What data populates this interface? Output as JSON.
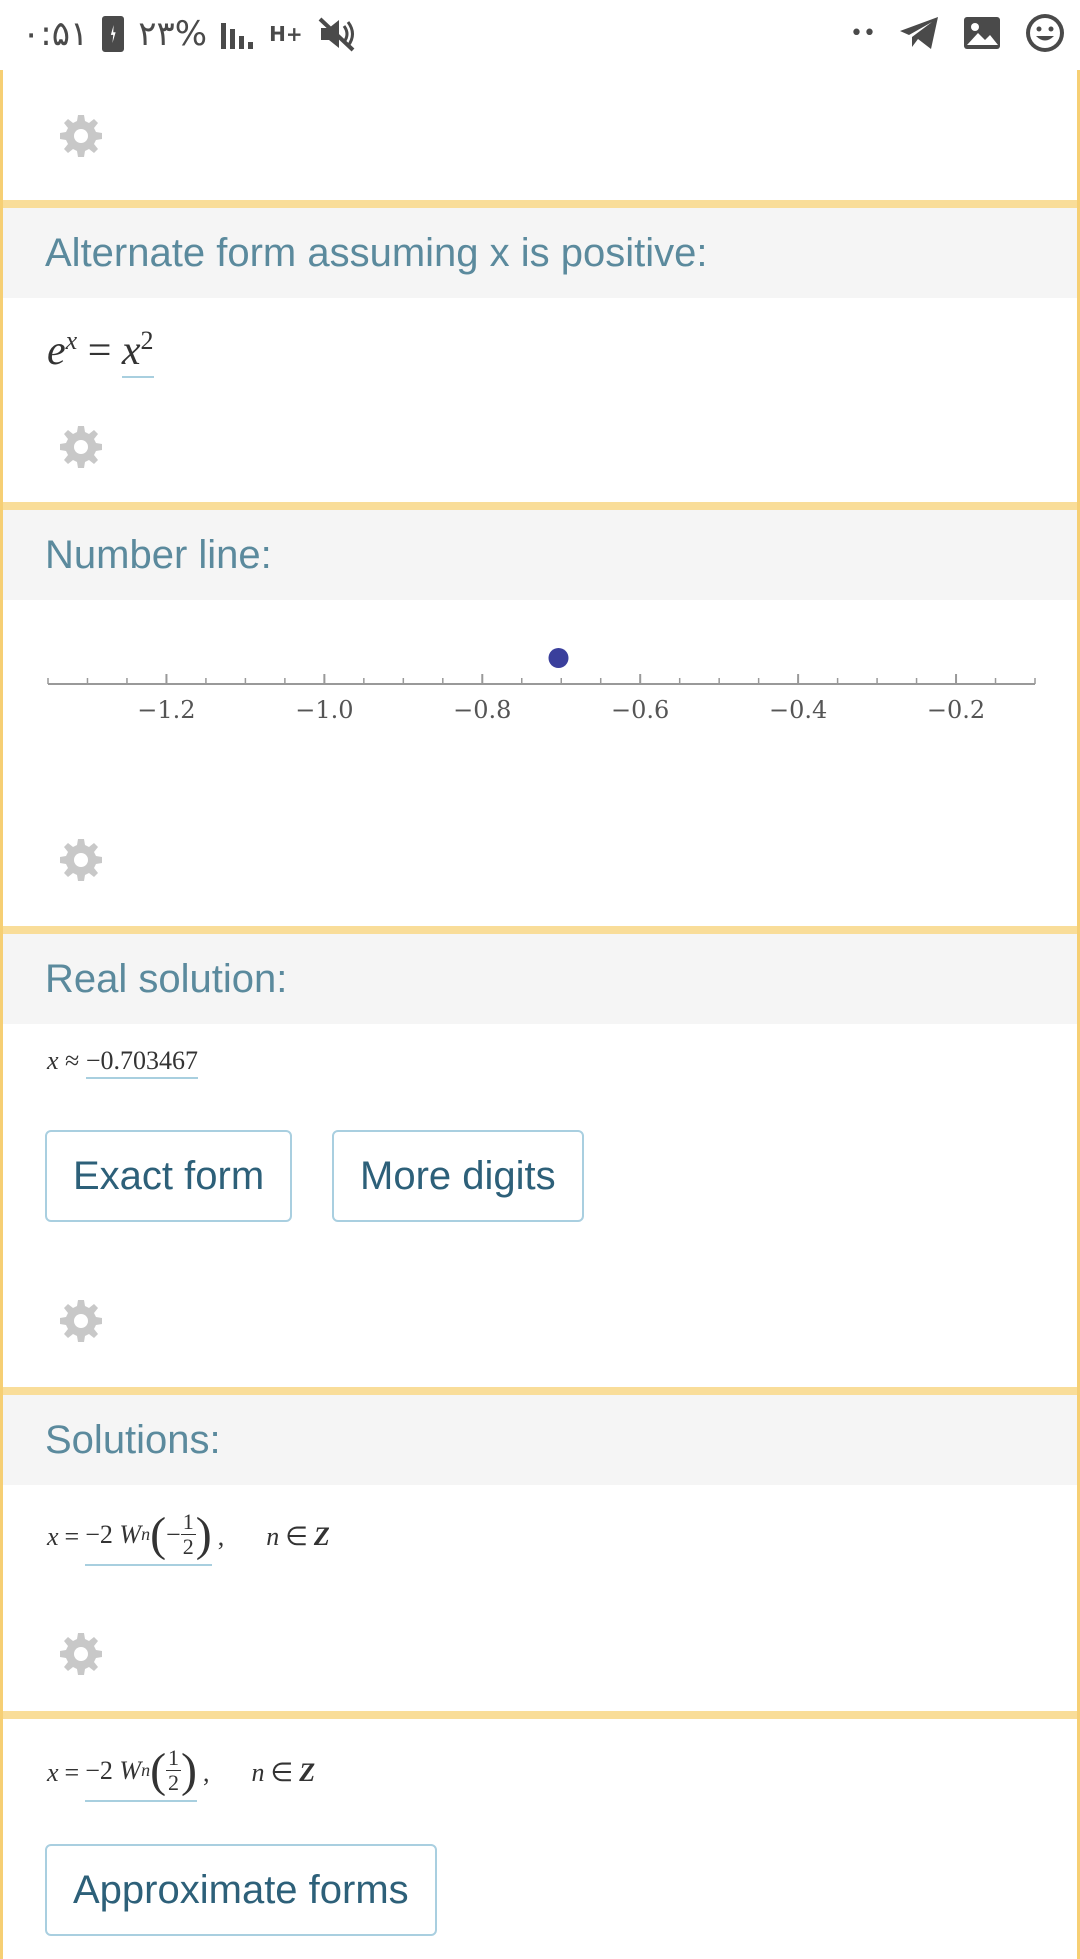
{
  "status_bar": {
    "time": "۰:۵۱",
    "battery": "۲۳%",
    "network": "H+",
    "more": "••",
    "colors": {
      "icons": "#4a4a4a"
    }
  },
  "pods": {
    "alternate_form": {
      "title": "Alternate form assuming x is positive:",
      "lhs_base": "e",
      "lhs_exp": "x",
      "eq": "=",
      "rhs_base": "x",
      "rhs_exp": "2"
    },
    "number_line": {
      "title": "Number line:",
      "ticks": [
        "−1.2",
        "−1.0",
        "−0.8",
        "−0.6",
        "−0.4",
        "−0.2"
      ],
      "point_value": -0.703467,
      "range": [
        -1.35,
        -0.1
      ],
      "point_color": "#3a3f9c"
    },
    "real_solution": {
      "title": "Real solution:",
      "var": "x",
      "approx": "≈",
      "value": "−0.703467",
      "buttons": {
        "exact_form": "Exact form",
        "more_digits": "More digits"
      }
    },
    "solutions": {
      "title": "Solutions:",
      "sol1": {
        "var": "x",
        "eq": "=",
        "coef": "−2",
        "W": "W",
        "sub": "n",
        "sign": "−",
        "num": "1",
        "den": "2",
        "comma": ",",
        "n": "n",
        "in": "∈",
        "Z": "Z"
      },
      "sol2": {
        "var": "x",
        "eq": "=",
        "coef": "−2",
        "W": "W",
        "sub": "n",
        "num": "1",
        "den": "2",
        "comma": ",",
        "n": "n",
        "in": "∈",
        "Z": "Z"
      },
      "buttons": {
        "approximate_forms": "Approximate forms"
      }
    }
  },
  "colors": {
    "pod_border": "#f6cf74",
    "header_text": "#5b8a9d",
    "header_bg": "#f5f5f5",
    "button_border": "#a9cfe0",
    "button_text": "#2d6079",
    "gear": "#c8c8c8"
  }
}
